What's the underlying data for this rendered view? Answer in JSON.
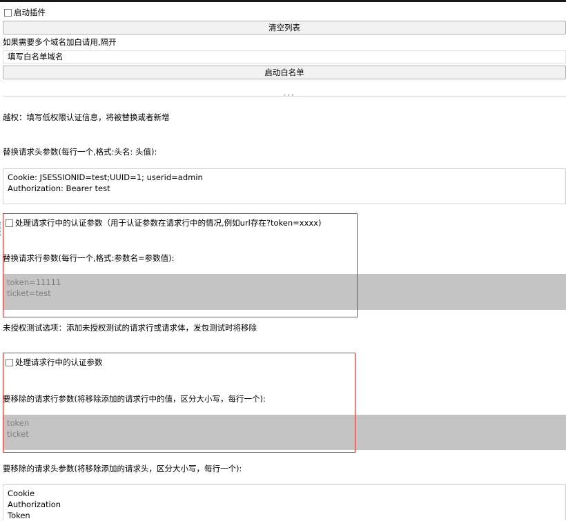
{
  "plugin": {
    "enable_label": "启动插件",
    "enabled": false
  },
  "clear_button_label": "清空列表",
  "whitelist": {
    "hint": "如果需要多个域名加白请用,隔开",
    "input_value": "填写白名单域名",
    "start_button_label": "启动白名单"
  },
  "privilege_escalation": {
    "heading": "越权：填写低权限认证信息，将被替换或者新增",
    "header_params_label": "替换请求头参数(每行一个,格式:头名: 头值):",
    "header_params_value": "Cookie: JSESSIONID=test;UUID=1; userid=admin\nAuthorization: Bearer test",
    "request_line_checkbox_label": "处理请求行中的认证参数（用于认证参数在请求行中的情况,例如url存在?token=xxxx)",
    "request_line_params_label": "替换请求行参数(每行一个,格式:参数名=参数值):",
    "request_line_params_value": "token=11111\nticket=test"
  },
  "unauthorized": {
    "heading": "未授权测试选项：添加未授权测试的请求行或请求体，发包测试时将移除",
    "request_line_checkbox_label": "处理请求行中的认证参数",
    "remove_line_params_label": "要移除的请求行参数(将移除添加的请求行中的值，区分大小写，每行一个):",
    "remove_line_params_value": "token\nticket",
    "remove_header_params_label": "要移除的请求头参数(将移除添加的请求头，区分大小写，每行一个):",
    "remove_header_params_value": "Cookie\nAuthorization\nToken"
  },
  "colors": {
    "highlight_border": "#d9312a",
    "disabled_area": "#c4c4c4"
  }
}
